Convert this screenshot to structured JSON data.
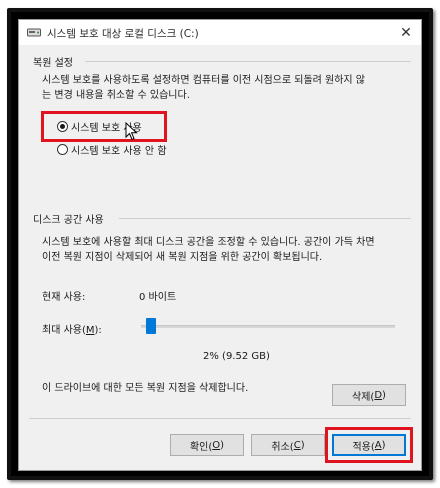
{
  "window": {
    "title": "시스템 보호 대상 로컬 디스크 (C:)",
    "close_symbol": "✕"
  },
  "restore_settings": {
    "section_title": "복원 설정",
    "description_line1": "시스템 보호를 사용하도록 설정하면 컴퓨터를 이전 시점으로 되돌려 원하지 않",
    "description_line2": "는 변경 내용을 취소할 수 있습니다.",
    "options": [
      {
        "label": "시스템 보호 사용",
        "checked": true
      },
      {
        "label": "시스템 보호 사용 안 함",
        "checked": false
      }
    ]
  },
  "disk_space": {
    "section_title": "디스크 공간 사용",
    "description_line1": "시스템 보호에 사용할 최대 디스크 공간을 조정할 수 있습니다. 공간이 가득 차면",
    "description_line2": "이전 복원 지점이 삭제되어 새 복원 지점을 위한 공간이 확보됩니다.",
    "current_usage_label": "현재 사용:",
    "current_usage_value": "0 바이트",
    "max_usage_label_prefix": "최대 사용(",
    "max_usage_label_key": "M",
    "max_usage_label_suffix": "):",
    "max_usage_percent": 2,
    "max_usage_value": "2% (9.52 GB)",
    "delete_text": "이 드라이브에 대한 모든 복원 지점을 삭제합니다.",
    "delete_button_prefix": "삭제(",
    "delete_button_key": "D",
    "delete_button_suffix": ")"
  },
  "buttons": {
    "ok_prefix": "확인(",
    "ok_key": "O",
    "ok_suffix": ")",
    "cancel_prefix": "취소(",
    "cancel_key": "C",
    "cancel_suffix": ")",
    "apply_prefix": "적용(",
    "apply_key": "A",
    "apply_suffix": ")"
  },
  "colors": {
    "highlight": "#e0141e",
    "accent": "#0078d7"
  }
}
